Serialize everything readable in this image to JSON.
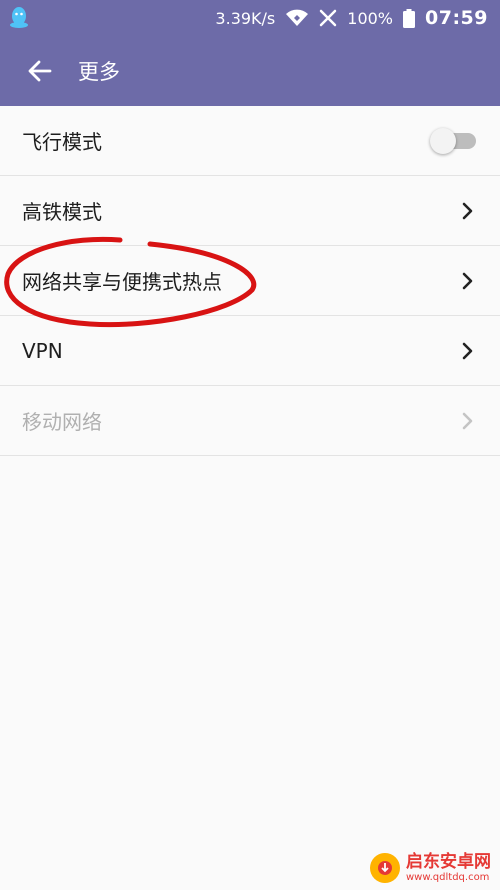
{
  "status_bar": {
    "speed": "3.39K/s",
    "battery": "100%",
    "time": "07:59",
    "icons": [
      "qq-icon",
      "wifi-icon",
      "no-signal-icon",
      "battery-icon"
    ]
  },
  "app_bar": {
    "title": "更多",
    "back_icon": "arrow-left-icon"
  },
  "settings": [
    {
      "label": "飞行模式",
      "control": "toggle",
      "toggle_on": false,
      "enabled": true
    },
    {
      "label": "高铁模式",
      "control": "chevron",
      "enabled": true
    },
    {
      "label": "网络共享与便携式热点",
      "control": "chevron",
      "enabled": true,
      "highlighted": true
    },
    {
      "label": "VPN",
      "control": "chevron",
      "enabled": true
    },
    {
      "label": "移动网络",
      "control": "chevron",
      "enabled": false
    }
  ],
  "watermark": {
    "title": "启东安卓网",
    "url": "www.qdltdq.com"
  },
  "colors": {
    "header": "#6d6ba8",
    "annotation": "#d81313"
  }
}
